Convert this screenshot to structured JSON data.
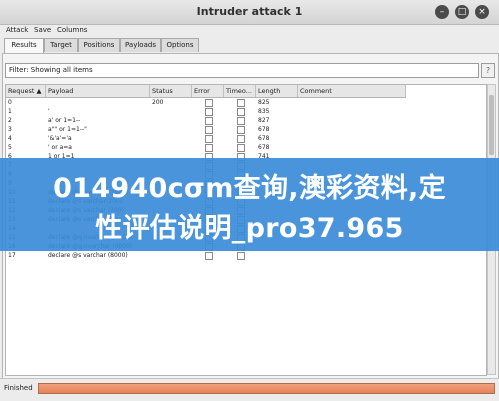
{
  "window": {
    "title": "Intruder attack 1"
  },
  "menu": [
    "Attack",
    "Save",
    "Columns"
  ],
  "tabs": [
    "Results",
    "Target",
    "Positions",
    "Payloads",
    "Options"
  ],
  "active_tab": "Results",
  "filter": {
    "text": "Filter: Showing all items"
  },
  "table": {
    "columns": [
      "Request ▲",
      "Payload",
      "Status",
      "Error",
      "Timeo...",
      "Length",
      "Comment"
    ],
    "rows": [
      {
        "request": "0",
        "payload": "",
        "status": "200",
        "length": "825"
      },
      {
        "request": "1",
        "payload": "'",
        "status": "",
        "length": "835"
      },
      {
        "request": "2",
        "payload": "a' or 1=1--",
        "status": "",
        "length": "827"
      },
      {
        "request": "3",
        "payload": "a\"\" or 1=1--\"",
        "status": "",
        "length": "678"
      },
      {
        "request": "4",
        "payload": "'&'a'='a",
        "status": "",
        "length": "678"
      },
      {
        "request": "5",
        "payload": "' or a=a",
        "status": "",
        "length": "678"
      },
      {
        "request": "6",
        "payload": "1 or 1=1",
        "status": "",
        "length": "741"
      },
      {
        "request": "7",
        "payload": "",
        "status": "",
        "length": ""
      },
      {
        "request": "8",
        "payload": "",
        "status": "",
        "length": ""
      },
      {
        "request": "9",
        "payload": "",
        "status": "",
        "length": ""
      },
      {
        "request": "10",
        "payload": "declare @q nvarchar (200)",
        "status": "",
        "length": ""
      },
      {
        "request": "11",
        "payload": "declare @s varchar(200)",
        "status": "",
        "length": ""
      },
      {
        "request": "12",
        "payload": "declare @s varchar (200)",
        "status": "",
        "length": ""
      },
      {
        "request": "13",
        "payload": "declare @s varchar(22)",
        "status": "",
        "length": ""
      },
      {
        "request": "14",
        "payload": "",
        "status": "",
        "length": ""
      },
      {
        "request": "15",
        "payload": "declare @q nvarchar (4000)",
        "status": "",
        "length": ""
      },
      {
        "request": "16",
        "payload": "declare @q nvarchar (4000)",
        "status": "",
        "length": ""
      },
      {
        "request": "17",
        "payload": "declare @s varchar (8000)",
        "status": "",
        "length": ""
      }
    ]
  },
  "overlay": {
    "line1": "014940cσm查询,澳彩资料,定",
    "line2": "性评估说明_pro37.965"
  },
  "status": {
    "text": "Finished",
    "progress_fraction": 1.0
  },
  "colors": {
    "overlay": "#3a8bd8",
    "progress": "#e5835b"
  }
}
